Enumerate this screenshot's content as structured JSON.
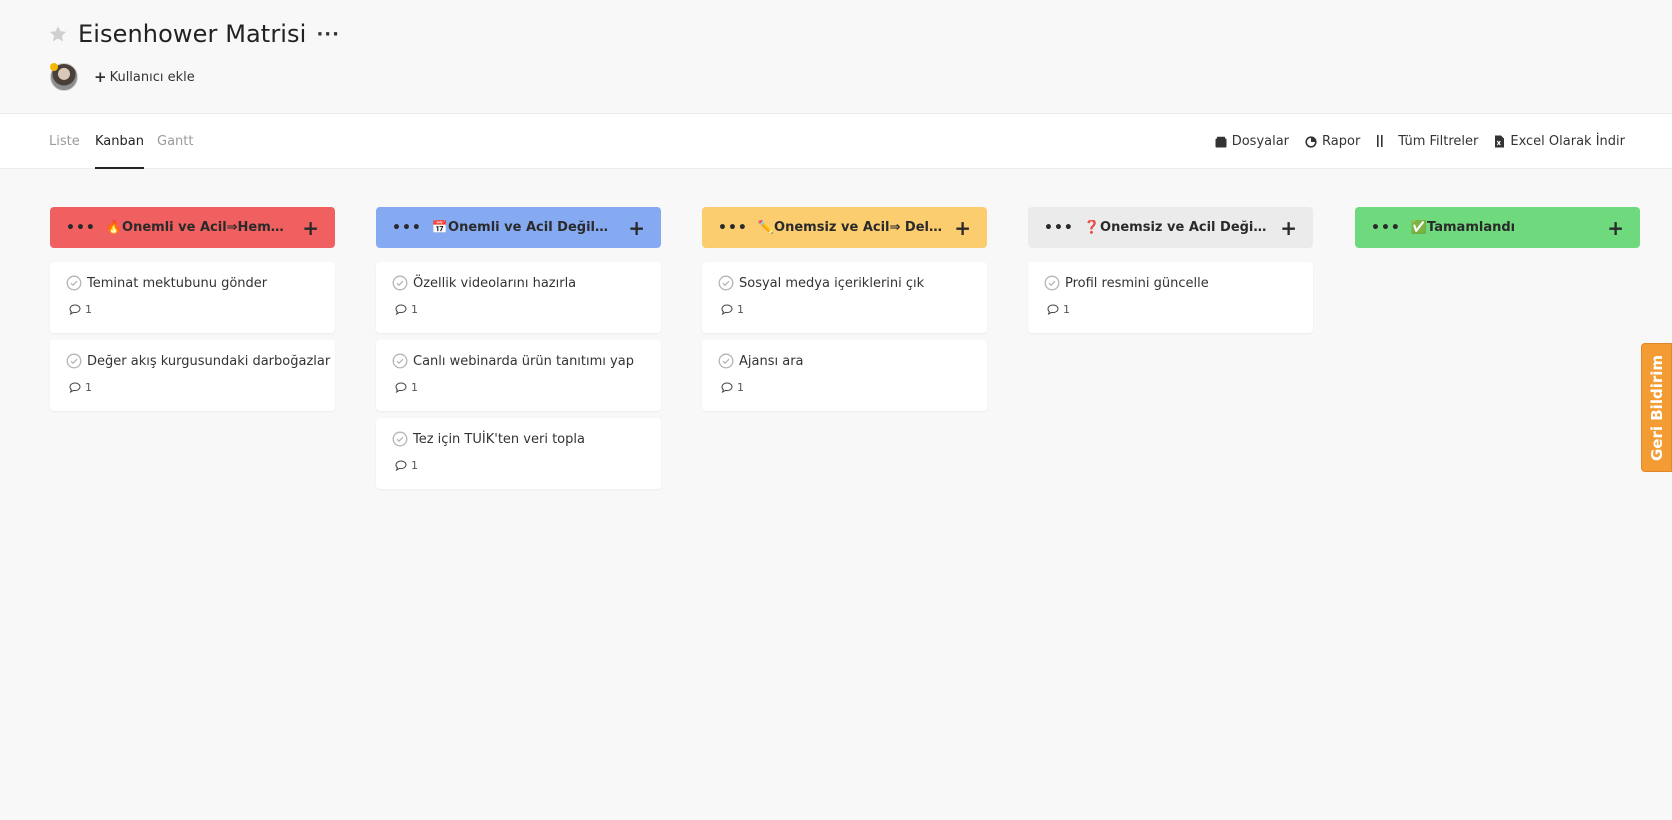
{
  "header": {
    "title": "Eisenhower Matrisi",
    "more_label": "···",
    "add_user_label": "Kullanıcı ekle"
  },
  "tabs": [
    {
      "label": "Liste",
      "active": false
    },
    {
      "label": "Kanban",
      "active": true
    },
    {
      "label": "Gantt",
      "active": false
    }
  ],
  "toolbar": {
    "files_label": "Dosyalar",
    "report_label": "Rapor",
    "filters_label": "Tüm Filtreler",
    "excel_label": "Excel Olarak İndir"
  },
  "colors": {
    "col1": "#f06060",
    "col2": "#86aaf2",
    "col3": "#fccd6f",
    "col4": "#ebebeb",
    "col5": "#6fd97d",
    "feedback": "#f39c34"
  },
  "columns": [
    {
      "title": "🔥Önemli ve Acil⇒Hemen Yap!",
      "cards": [
        {
          "title": "Teminat mektubunu gönder",
          "comments": "1"
        },
        {
          "title": "Değer akış kurgusundaki darboğazlar",
          "comments": "1"
        }
      ]
    },
    {
      "title": "📅Önemli ve Acil Değil⇒Planla",
      "cards": [
        {
          "title": "Özellik videolarını hazırla",
          "comments": "1"
        },
        {
          "title": "Canlı webinarda ürün tanıtımı yap",
          "comments": "1"
        },
        {
          "title": "Tez için TUİK'ten veri topla",
          "comments": "1"
        }
      ]
    },
    {
      "title": "✏️Önemsiz ve Acil⇒ Delege Et",
      "cards": [
        {
          "title": "Sosyal medya içeriklerini çık",
          "comments": "1"
        },
        {
          "title": "Ajansı ara",
          "comments": "1"
        }
      ]
    },
    {
      "title": "❓Önemsiz ve Acil Değil⇒ Sor...",
      "cards": [
        {
          "title": "Profil resmini güncelle",
          "comments": "1"
        }
      ]
    },
    {
      "title": "✅Tamamlandı",
      "cards": []
    }
  ],
  "feedback_label": "Geri Bildirim"
}
